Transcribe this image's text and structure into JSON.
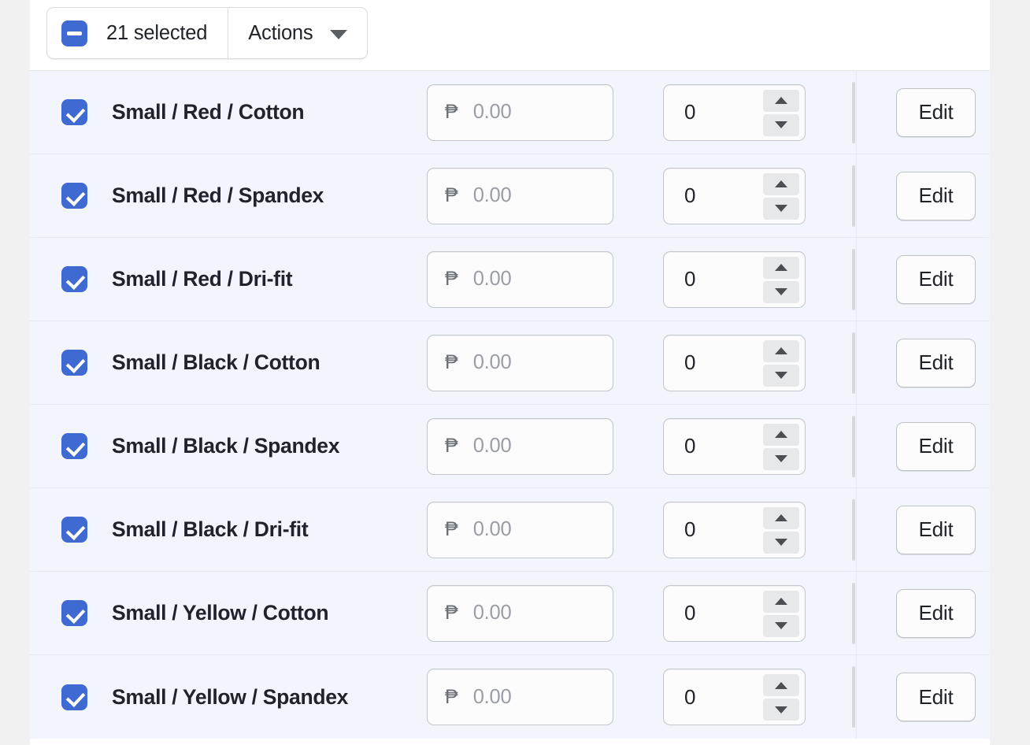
{
  "bulk_bar": {
    "select_all_checkbox_state": "indeterminate",
    "selection_label": "21 selected",
    "actions_label": "Actions",
    "actions_caret_icon": "chevron-down-icon"
  },
  "table": {
    "currency_symbol": "₱",
    "price_placeholder": "0.00",
    "edit_label": "Edit",
    "rows": [
      {
        "title": "Small / Red / Cotton",
        "checked": true,
        "price": "",
        "quantity": "0"
      },
      {
        "title": "Small / Red / Spandex",
        "checked": true,
        "price": "",
        "quantity": "0"
      },
      {
        "title": "Small / Red / Dri-fit",
        "checked": true,
        "price": "",
        "quantity": "0"
      },
      {
        "title": "Small / Black / Cotton",
        "checked": true,
        "price": "",
        "quantity": "0"
      },
      {
        "title": "Small / Black / Spandex",
        "checked": true,
        "price": "",
        "quantity": "0"
      },
      {
        "title": "Small / Black / Dri-fit",
        "checked": true,
        "price": "",
        "quantity": "0"
      },
      {
        "title": "Small / Yellow / Cotton",
        "checked": true,
        "price": "",
        "quantity": "0"
      },
      {
        "title": "Small / Yellow / Spandex",
        "checked": true,
        "price": "",
        "quantity": "0"
      }
    ]
  },
  "colors": {
    "accent": "#3f6ad1",
    "row_selected_bg": "#f2f5fc",
    "page_bg": "#f1f1f1",
    "card_bg": "#ffffff",
    "border": "#c3c6cb"
  }
}
